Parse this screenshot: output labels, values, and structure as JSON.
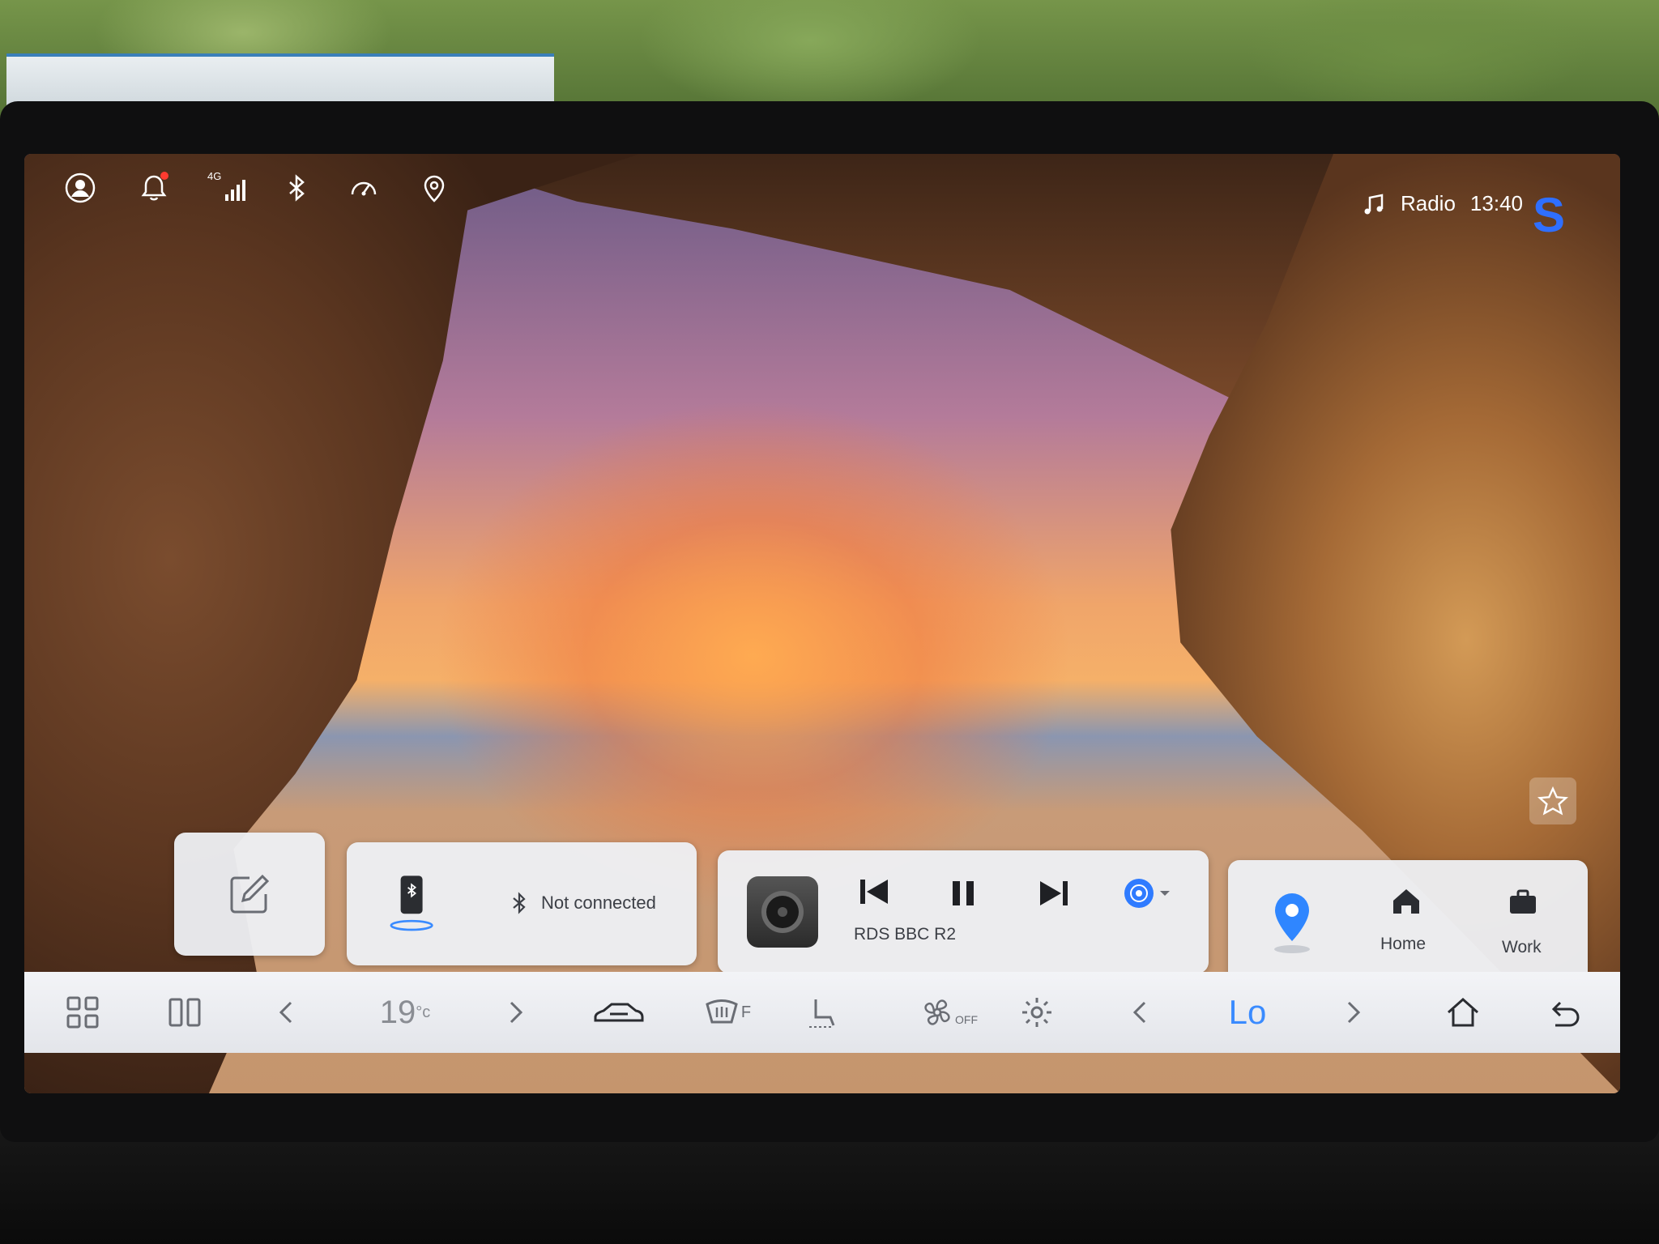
{
  "status_bar": {
    "network_label": "4G",
    "now_playing_source": "Radio",
    "time": "13:40",
    "icons": [
      "user-icon",
      "bell-icon",
      "signal-icon",
      "bluetooth-icon",
      "gauge-icon",
      "location-icon",
      "music-note-icon"
    ],
    "notification_dot_color": "#ff3b30",
    "brand_letter": "S",
    "brand_color": "#2f6fff"
  },
  "widgets": {
    "bluetooth": {
      "status": "Not connected"
    },
    "media": {
      "station": "RDS BBC R2"
    },
    "navigation": {
      "home_label": "Home",
      "work_label": "Work"
    }
  },
  "dock": {
    "temperature_value": "19",
    "temperature_unit": "°c",
    "fan_state": "OFF",
    "defrost_label": "F",
    "right_temp": "Lo",
    "accent_color": "#3a8bff"
  }
}
